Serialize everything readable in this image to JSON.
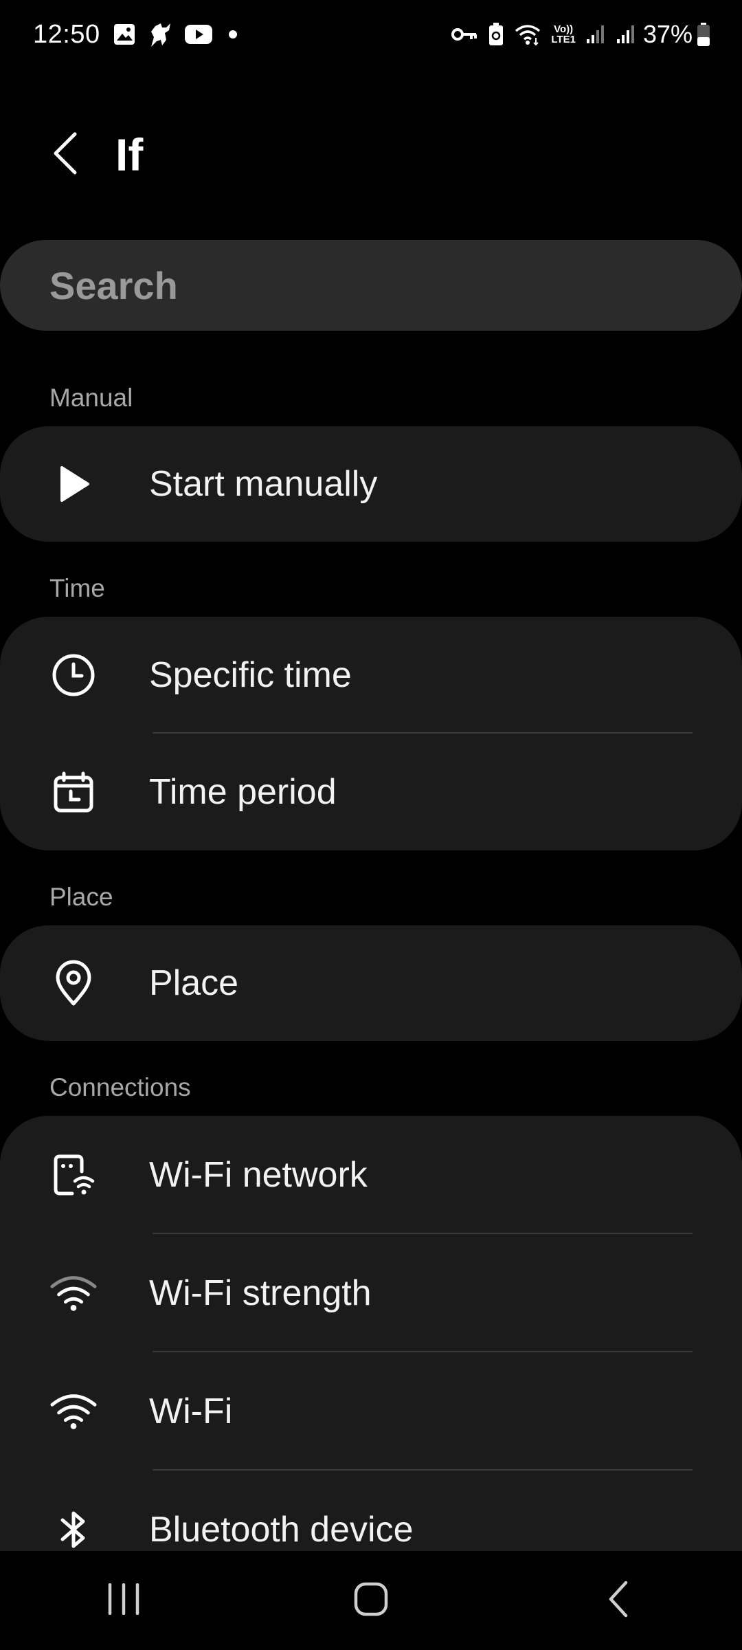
{
  "status_bar": {
    "time": "12:50",
    "battery_percent": "37%",
    "left_icons": [
      "gallery-icon",
      "horse-icon",
      "youtube-icon",
      "dot-icon"
    ],
    "right_icons": [
      "vpn-key-icon",
      "battery-saver-icon",
      "wifi-icon",
      "volte-icon",
      "signal-icon",
      "signal-icon",
      "battery-icon"
    ],
    "volte_label_top": "Vo))",
    "volte_label_bottom": "LTE1"
  },
  "header": {
    "title": "If",
    "back_icon": "back-arrow-icon"
  },
  "search": {
    "placeholder": "Search"
  },
  "sections": [
    {
      "label": "Manual",
      "items": [
        {
          "label": "Start manually",
          "icon": "play-icon"
        }
      ]
    },
    {
      "label": "Time",
      "items": [
        {
          "label": "Specific time",
          "icon": "clock-icon"
        },
        {
          "label": "Time period",
          "icon": "calendar-clock-icon"
        }
      ]
    },
    {
      "label": "Place",
      "items": [
        {
          "label": "Place",
          "icon": "location-pin-icon"
        }
      ]
    },
    {
      "label": "Connections",
      "items": [
        {
          "label": "Wi-Fi network",
          "icon": "wifi-network-icon"
        },
        {
          "label": "Wi-Fi strength",
          "icon": "wifi-strength-icon"
        },
        {
          "label": "Wi-Fi",
          "icon": "wifi-icon"
        },
        {
          "label": "Bluetooth device",
          "icon": "bluetooth-icon"
        }
      ]
    }
  ],
  "nav_bar": {
    "buttons": [
      "recents-icon",
      "home-icon",
      "back-icon"
    ]
  },
  "colors": {
    "background": "#000000",
    "card": "#1b1b1b",
    "search_bg": "#2b2b2b",
    "section_label": "#a8a8a8",
    "divider": "#3a3a3a"
  }
}
